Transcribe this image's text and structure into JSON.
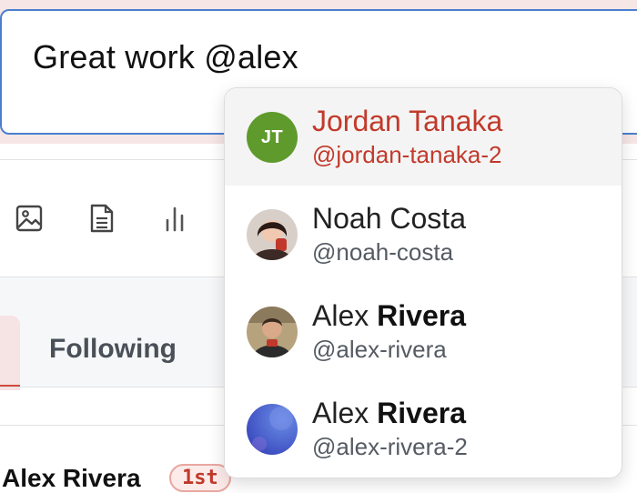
{
  "composer": {
    "text": "Great work @alex"
  },
  "toolbar": {
    "icons": [
      "image-icon",
      "document-icon",
      "poll-icon"
    ]
  },
  "tabs": {
    "following_label": "Following"
  },
  "post": {
    "author": "Alex Rivera",
    "badge": "1st"
  },
  "mention_suggestions": [
    {
      "name": "Jordan Tanaka",
      "name_plain": "Jordan Tanaka",
      "name_bold": "",
      "handle": "@jordan-tanaka-2",
      "initials": "JT",
      "avatar_color": "#5f9a2c",
      "highlighted": true
    },
    {
      "name": "Noah Costa",
      "name_plain": "Noah Costa",
      "name_bold": "",
      "handle": "@noah-costa",
      "initials": "",
      "avatar_color": "#8a5a48",
      "highlighted": false
    },
    {
      "name": "Alex Rivera",
      "name_plain": "Alex ",
      "name_bold": "Rivera",
      "handle": "@alex-rivera",
      "initials": "",
      "avatar_color": "#6b5a44",
      "highlighted": false
    },
    {
      "name": "Alex Rivera",
      "name_plain": "Alex ",
      "name_bold": "Rivera",
      "handle": "@alex-rivera-2",
      "initials": "",
      "avatar_color": "#3f51c9",
      "highlighted": false
    }
  ],
  "colors": {
    "accent_red": "#c23a2b",
    "focus_blue": "#4a7fd0",
    "highlight_bg": "#f4f4f4"
  }
}
